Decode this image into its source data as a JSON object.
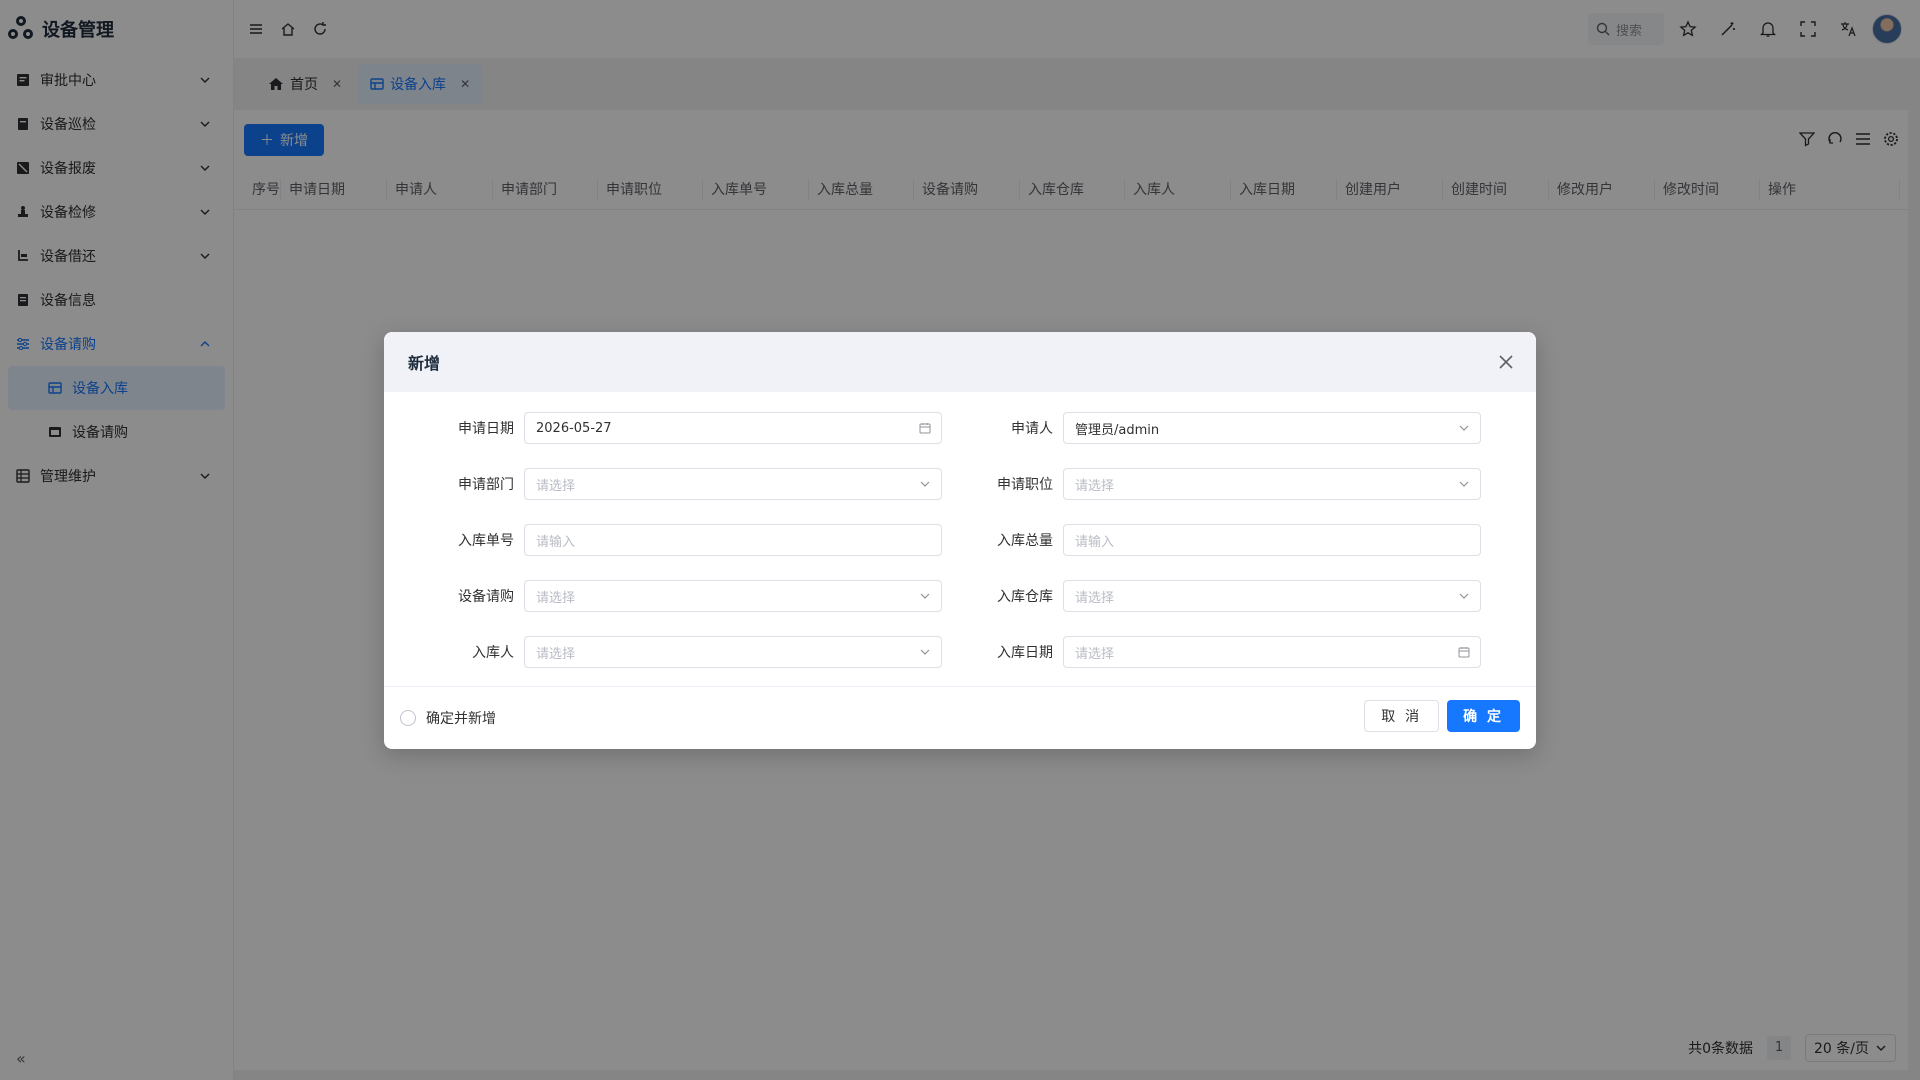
{
  "app": {
    "title": "设备管理"
  },
  "sidebar": {
    "items": [
      {
        "label": "审批中心",
        "icon": "approval-icon",
        "expandable": true
      },
      {
        "label": "设备巡检",
        "icon": "inspection-icon",
        "expandable": true
      },
      {
        "label": "设备报废",
        "icon": "scrap-icon",
        "expandable": true
      },
      {
        "label": "设备检修",
        "icon": "repair-icon",
        "expandable": true
      },
      {
        "label": "设备借还",
        "icon": "borrow-icon",
        "expandable": true
      },
      {
        "label": "设备信息",
        "icon": "info-icon",
        "expandable": false
      },
      {
        "label": "设备请购",
        "icon": "purchase-icon",
        "expandable": true,
        "open": true
      },
      {
        "label": "管理维护",
        "icon": "maintenance-icon",
        "expandable": true
      }
    ],
    "sub_items": [
      {
        "label": "设备入库",
        "active": true
      },
      {
        "label": "设备请购",
        "active": false
      }
    ]
  },
  "topbar": {
    "search_label": "搜索"
  },
  "tabs": [
    {
      "label": "首页",
      "active": false
    },
    {
      "label": "设备入库",
      "active": true
    }
  ],
  "toolbar": {
    "add_label": "新增"
  },
  "table": {
    "columns": [
      "序号",
      "申请日期",
      "申请人",
      "申请部门",
      "申请职位",
      "入库单号",
      "入库总量",
      "设备请购",
      "入库仓库",
      "入库人",
      "入库日期",
      "创建用户",
      "创建时间",
      "修改用户",
      "修改时间",
      "操作"
    ]
  },
  "pager": {
    "total_text": "共0条数据",
    "page": "1",
    "page_size": "20 条/页"
  },
  "modal": {
    "title": "新增",
    "fields": [
      {
        "label": "申请日期",
        "value": "2026-05-27",
        "placeholder": "",
        "type": "date"
      },
      {
        "label": "申请人",
        "value": "管理员/admin",
        "placeholder": "",
        "type": "select"
      },
      {
        "label": "申请部门",
        "value": "",
        "placeholder": "请选择",
        "type": "select"
      },
      {
        "label": "申请职位",
        "value": "",
        "placeholder": "请选择",
        "type": "select"
      },
      {
        "label": "入库单号",
        "value": "",
        "placeholder": "请输入",
        "type": "input"
      },
      {
        "label": "入库总量",
        "value": "",
        "placeholder": "请输入",
        "type": "input"
      },
      {
        "label": "设备请购",
        "value": "",
        "placeholder": "请选择",
        "type": "select"
      },
      {
        "label": "入库仓库",
        "value": "",
        "placeholder": "请选择",
        "type": "select"
      },
      {
        "label": "入库人",
        "value": "",
        "placeholder": "请选择",
        "type": "select"
      },
      {
        "label": "入库日期",
        "value": "",
        "placeholder": "请选择",
        "type": "date"
      }
    ],
    "checkbox_label": "确定并新增",
    "cancel_label": "取 消",
    "confirm_label": "确 定"
  },
  "colors": {
    "primary": "#1677ff",
    "mask": "rgba(0,0,0,0.45)"
  }
}
